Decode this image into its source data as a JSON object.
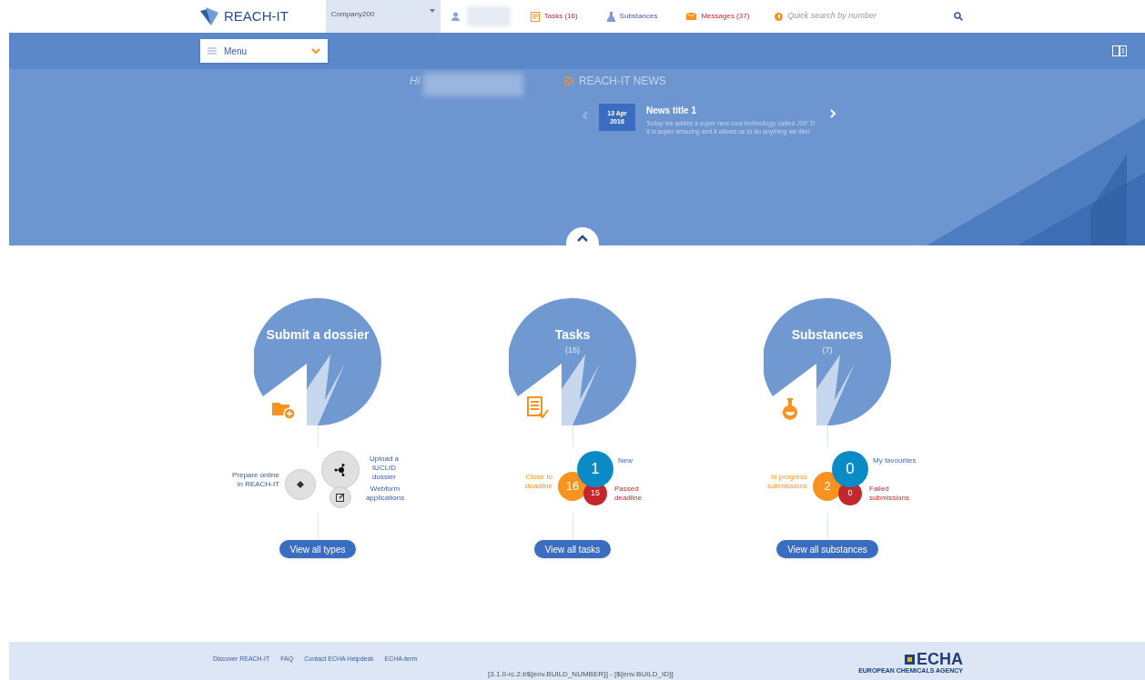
{
  "header": {
    "logo": "REACH-IT",
    "company": "Company200",
    "nav": [
      {
        "label": "Tasks (16)",
        "kind": "tasks"
      },
      {
        "label": "Substances",
        "kind": "substances"
      },
      {
        "label": "Messages (37)",
        "kind": "messages"
      }
    ],
    "search": {
      "placeholder": "Quick search by number"
    }
  },
  "menu": {
    "label": "Menu"
  },
  "hero": {
    "greeting": "Hi",
    "news_heading": "REACH-IT NEWS",
    "news": {
      "day": "13 Apr",
      "year": "2016",
      "title": "News title 1",
      "body": "Today we added a super new cool technology, called JSF 2! It is super amazing and it allows us to do anything we like!"
    }
  },
  "cards": [
    {
      "kind": "dossier",
      "title": "Submit a dossier",
      "options": [
        {
          "label": "Upload a IUCLID dossier",
          "kind": "upload"
        },
        {
          "label": "Prepare online in REACH-IT",
          "kind": "online"
        },
        {
          "label": "Webform applications",
          "kind": "webform"
        }
      ],
      "button": "View all types"
    },
    {
      "kind": "tasks",
      "title": "Tasks",
      "count": "(16)",
      "stats": [
        {
          "label": "New",
          "value": "1",
          "kind": "main"
        },
        {
          "label": "Close to deadline",
          "value": "16",
          "kind": "warn"
        },
        {
          "label": "Passed deadline",
          "value": "15",
          "kind": "bad"
        }
      ],
      "button": "View all tasks"
    },
    {
      "kind": "substances",
      "title": "Substances",
      "count": "(7)",
      "stats": [
        {
          "label": "My favourites",
          "value": "0",
          "kind": "main"
        },
        {
          "label": "In progress submissions",
          "value": "2",
          "kind": "warn"
        },
        {
          "label": "Failed submissions",
          "value": "0",
          "kind": "bad"
        }
      ],
      "button": "View all substances"
    }
  ],
  "footer": {
    "links": [
      "Discover REACH-IT",
      "FAQ",
      "Contact ECHA Helpdesk",
      "ECHA-term"
    ],
    "version": "[3.1.0-rc.2.b${env.BUILD_NUMBER}] - [${env.BUILD_ID}]",
    "logo": "ECHA",
    "logo_sub": "EUROPEAN CHEMICALS AGENCY"
  }
}
